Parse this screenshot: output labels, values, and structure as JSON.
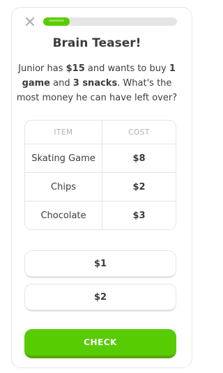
{
  "header": {
    "close_icon": "close-icon",
    "progress_fraction": 0.2
  },
  "lesson": {
    "title": "Brain Teaser!",
    "question_parts": {
      "p1": "Junior has ",
      "p2": "$15",
      "p3": " and wants to buy ",
      "p4": "1 game",
      "p5": " and ",
      "p6": "3 snacks",
      "p7": ". What's the most money he can have left over?"
    }
  },
  "table": {
    "headers": {
      "item": "ITEM",
      "cost": "COST"
    },
    "rows": [
      {
        "item": "Skating Game",
        "cost": "$8"
      },
      {
        "item": "Chips",
        "cost": "$2"
      },
      {
        "item": "Chocolate",
        "cost": "$3"
      }
    ]
  },
  "options": [
    {
      "label": "$1"
    },
    {
      "label": "$2"
    }
  ],
  "footer": {
    "check_label": "CHECK"
  },
  "colors": {
    "accent": "#58cc02",
    "accent_dark": "#58a700",
    "border": "#e5e5e5",
    "muted_text": "#afafaf"
  }
}
